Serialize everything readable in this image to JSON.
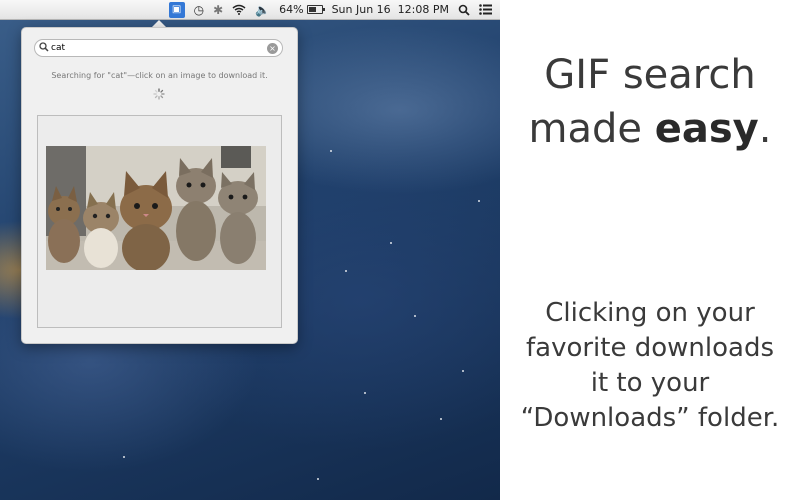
{
  "menubar": {
    "app_icon": "tv-icon",
    "battery_percent": "64%",
    "battery_level": 0.64,
    "clock": "Sun Jun 16  12:08 PM",
    "icons": [
      "tv-icon",
      "time-machine-icon",
      "bluetooth-icon",
      "wifi-icon",
      "volume-icon",
      "battery-icon",
      "spotlight-icon",
      "notification-center-icon"
    ]
  },
  "popover": {
    "search": {
      "value": "cat",
      "placeholder": ""
    },
    "status": "Searching for \"cat\"—click on an image to download it."
  },
  "marketing": {
    "headline_line1": "GIF search",
    "headline_line2_pre": "made ",
    "headline_line2_bold": "easy",
    "headline_line2_post": ".",
    "subtext_line1": "Clicking on your",
    "subtext_line2": "favorite downloads",
    "subtext_line3": "it to your",
    "subtext_line4": "“Downloads” folder."
  },
  "colors": {
    "menubar_app_accent": "#3478d6",
    "headline_text": "#3a3a3a"
  }
}
